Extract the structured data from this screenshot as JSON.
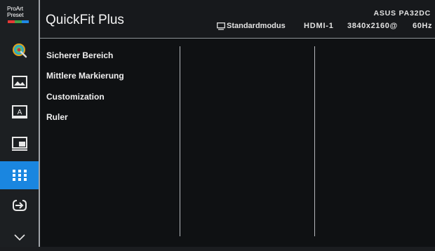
{
  "logo": {
    "line1": "ProArt",
    "line2": "Preset",
    "bar_colors": [
      "#e53935",
      "#43a047",
      "#1e88e5"
    ]
  },
  "sidebar": {
    "items": [
      {
        "icon": "color-palette-icon",
        "active": false
      },
      {
        "icon": "image-icon",
        "active": false
      },
      {
        "icon": "pip-text-icon",
        "active": false
      },
      {
        "icon": "pip-pbp-icon",
        "active": false
      },
      {
        "icon": "quickfit-grid-icon",
        "active": true
      },
      {
        "icon": "input-select-icon",
        "active": false
      },
      {
        "icon": "chevron-down-icon",
        "active": false
      }
    ]
  },
  "header": {
    "title": "QuickFit Plus",
    "model": "ASUS PA32DC",
    "mode_icon": "monitor-icon",
    "mode": "Standardmodus",
    "input": "HDMI-1",
    "resolution": "3840x2160@",
    "refresh": "60Hz"
  },
  "menu": {
    "items": [
      "Sicherer Bereich",
      "Mittlere Markierung",
      "Customization",
      "Ruler"
    ]
  },
  "colors": {
    "accent": "#1a86e0",
    "background": "#0f1113",
    "divider": "#b5b8bc"
  }
}
